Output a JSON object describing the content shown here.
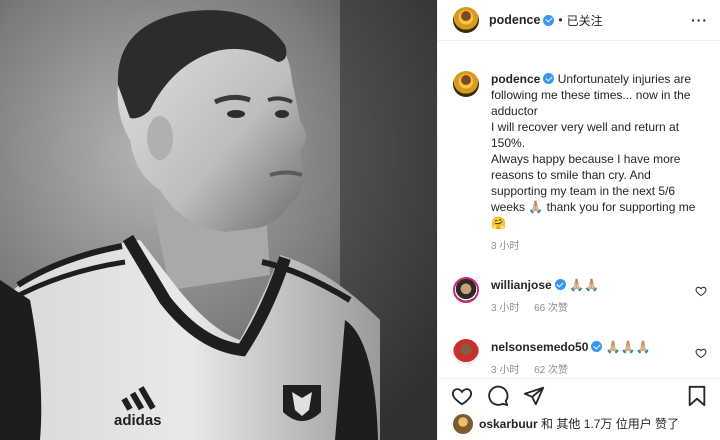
{
  "post": {
    "author": "podence",
    "follow_state": "已关注",
    "separator": "•",
    "more_label": "···"
  },
  "caption": {
    "author": "podence",
    "lines": [
      "Unfortunately injuries are following me these times... now in the adductor",
      "I will recover very well and return at 150%.",
      "Always happy because I have more reasons to smile than cry. And supporting my team in the next 5/6 weeks 🙏🏼 thank you for supporting me🤗"
    ],
    "time": "3 小时"
  },
  "comments": [
    {
      "user": "willianjose",
      "text": "🙏🏼🙏🏼",
      "time": "3 小时",
      "likes": "66 次赞"
    },
    {
      "user": "nelsonsemedo50",
      "text": "🙏🏼🙏🏼🙏🏼",
      "time": "3 小时",
      "likes": "62 次赞"
    }
  ],
  "likes_summary": {
    "user": "oskarbuur",
    "text": "和 其他 1.7万 位用户 赞了"
  },
  "icons": {
    "verified": "verified-badge-icon",
    "more": "more-options-icon",
    "like": "heart-icon",
    "comment": "comment-bubble-icon",
    "share": "paper-plane-icon",
    "save": "bookmark-icon"
  },
  "colors": {
    "verified": "#3897f0",
    "meta_text": "#8e8e8e",
    "divider": "#efefef"
  }
}
